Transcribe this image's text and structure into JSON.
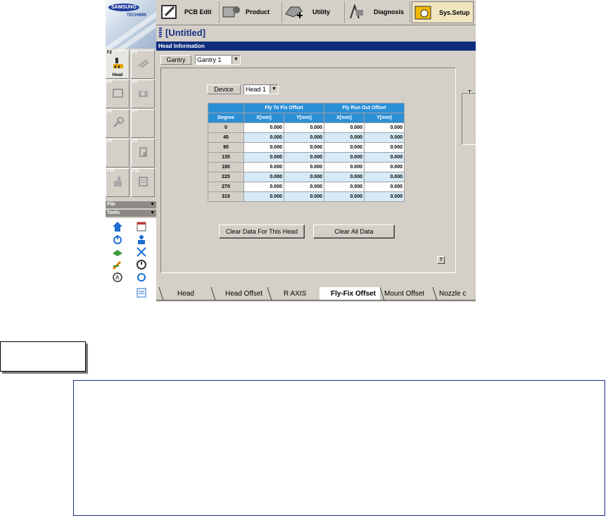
{
  "brand": {
    "name": "SAMSUNG",
    "sub": "TECHWIN"
  },
  "toolbar": [
    {
      "label": "PCB Edit",
      "icon": "pcb-edit-icon",
      "active": false
    },
    {
      "label": "Product",
      "icon": "product-icon",
      "active": false
    },
    {
      "label": "Utility",
      "icon": "utility-icon",
      "active": false
    },
    {
      "label": "Diagnosis",
      "icon": "diagnosis-icon",
      "active": false
    },
    {
      "label": "Sys.Setup",
      "icon": "sys-setup-icon",
      "active": true
    }
  ],
  "window_title": "[Untitled]",
  "section_header": "Head Information",
  "fkeys": [
    {
      "key": "F2",
      "name": "Head",
      "active": true
    },
    {
      "key": "F3",
      "name": "",
      "active": false
    },
    {
      "key": "F4",
      "name": "",
      "active": false
    },
    {
      "key": "F5",
      "name": "",
      "active": false
    },
    {
      "key": "F6",
      "name": "",
      "active": false
    },
    {
      "key": "F7",
      "name": "",
      "active": false
    },
    {
      "key": "F8",
      "name": "",
      "active": false
    },
    {
      "key": "F9",
      "name": "",
      "active": false
    },
    {
      "key": "F10",
      "name": "",
      "active": false
    },
    {
      "key": "F11",
      "name": "",
      "active": false
    }
  ],
  "menus": {
    "file": "File",
    "tools": "Tools"
  },
  "gantry": {
    "label": "Gantry",
    "value": "Gantry 1"
  },
  "device": {
    "label": "Device",
    "value": "Head 1"
  },
  "sidebox_title": "T",
  "table": {
    "group_headers": [
      "Fly To Fix Offset",
      "Fly Run Out Offset"
    ],
    "degree_header": "Degree",
    "sub_headers": [
      "X[mm]",
      "Y[mm]",
      "X[mm]",
      "Y[mm]"
    ],
    "rows": [
      {
        "degree": "0",
        "values": [
          "0.000",
          "0.000",
          "0.000",
          "0.000"
        ]
      },
      {
        "degree": "45",
        "values": [
          "0.000",
          "0.000",
          "0.000",
          "0.000"
        ]
      },
      {
        "degree": "90",
        "values": [
          "0.000",
          "0.000",
          "0.000",
          "0.000"
        ]
      },
      {
        "degree": "135",
        "values": [
          "0.000",
          "0.000",
          "0.000",
          "0.000"
        ]
      },
      {
        "degree": "180",
        "values": [
          "0.000",
          "0.000",
          "0.000",
          "0.000"
        ]
      },
      {
        "degree": "225",
        "values": [
          "0.000",
          "0.000",
          "0.000",
          "0.000"
        ]
      },
      {
        "degree": "270",
        "values": [
          "0.000",
          "0.000",
          "0.000",
          "0.000"
        ]
      },
      {
        "degree": "315",
        "values": [
          "0.000",
          "0.000",
          "0.000",
          "0.000"
        ]
      }
    ]
  },
  "buttons": {
    "clear_head": "Clear Data For This Head",
    "clear_all": "Clear All Data",
    "help": "?"
  },
  "tabs": [
    {
      "label": "Head",
      "active": false
    },
    {
      "label": "Head Offset",
      "active": false
    },
    {
      "label": "R AXIS",
      "active": false
    },
    {
      "label": "Fly-Fix Offset",
      "active": true
    },
    {
      "label": "Mount Offset",
      "active": false
    },
    {
      "label": "Nozzle c",
      "active": false
    }
  ],
  "colors": {
    "title_blue": "#1c2f86",
    "header_band": "#0f2d7d",
    "table_header": "#2b8fd6",
    "row_alt": "#d6eaf7"
  }
}
